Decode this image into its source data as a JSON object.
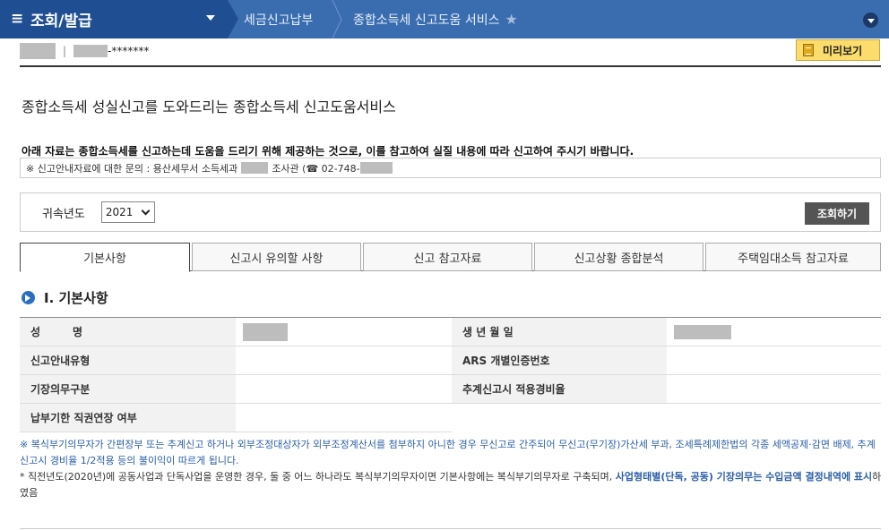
{
  "nav": {
    "menu_label": "조회/발급",
    "breadcrumb_1": "세금신고납부",
    "breadcrumb_2": "종합소득세 신고도움 서비스"
  },
  "user": {
    "id_masked": "-*******"
  },
  "toolbar": {
    "preview_label": "미리보기"
  },
  "page": {
    "title": "종합소득세 성실신고를 도와드리는 종합소득세 신고도움서비스",
    "notice": "아래 자료는 종합소득세를 신고하는데 도움을 드리기 위해 제공하는 것으로, 이를 참고하여 실질 내용에 따라 신고하여 주시기 바랍니다.",
    "inquiry_prefix": "※ 신고안내자료에 대한 문의 : 용산세무서 소득세과",
    "inquiry_mid": "조사관 (☎ 02-748-"
  },
  "search": {
    "label": "귀속년도",
    "selected_year": "2021",
    "button_label": "조회하기"
  },
  "tabs": [
    {
      "label": "기본사항"
    },
    {
      "label": "신고시 유의할 사항"
    },
    {
      "label": "신고 참고자료"
    },
    {
      "label": "신고상황 종합분석"
    },
    {
      "label": "주택임대소득 참고자료"
    }
  ],
  "section": {
    "title": "Ⅰ. 기본사항"
  },
  "table": {
    "name_label": "성　　　명",
    "birth_label": "생 년 월 일",
    "guide_type_label": "신고안내유형",
    "ars_label": "ARS 개별인증번호",
    "bookkeeping_label": "기장의무구분",
    "expense_rate_label": "추계신고시 적용경비율",
    "extension_label": "납부기한 직권연장 여부"
  },
  "footnotes": {
    "line1": "※ 복식부기의무자가 간편장부 또는 추계신고 하거나 외부조정대상자가 외부조정계산서를 첨부하지 아니한 경우 무신고로 간주되어 무신고(무기장)가산세 부과, 조세특례제한법의 각종 세액공제·감면 배제, 추계신고시 경비율 1/2적용 등의 불이익이 따르게 됩니다.",
    "line2_a": "* 직전년도(2020년)에 공동사업과 단독사업을 운영한 경우, 둘 중 어느 하나라도 복식부기의무자이면 기본사항에는 복식부기의무자로 구축되며, ",
    "line2_b": "사업형태별(단독, 공동) 기장의무는 수입금액 결정내역에 표시",
    "line2_c": "하였음"
  },
  "colors": {
    "nav_bg": "#3a6db0",
    "nav_menu_bg": "#1f4f92",
    "preview_bg": "#fbdc6c",
    "button_dark": "#545454",
    "accent_blue": "#2a6fbf"
  }
}
